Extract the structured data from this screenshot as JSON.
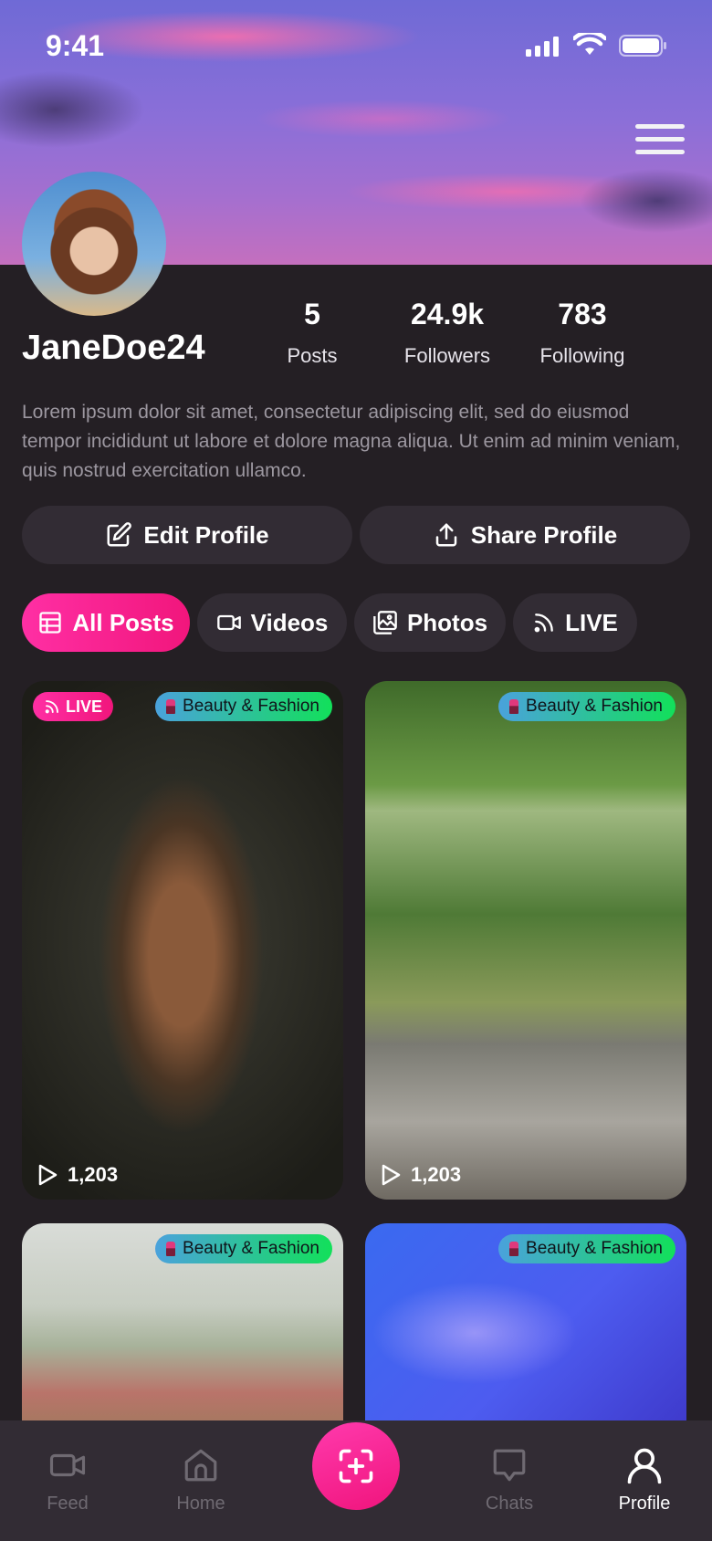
{
  "status_bar": {
    "time": "9:41"
  },
  "profile": {
    "username": "JaneDoe24",
    "stats": [
      {
        "value": "5",
        "label": "Posts"
      },
      {
        "value": "24.9k",
        "label": "Followers"
      },
      {
        "value": "783",
        "label": "Following"
      }
    ],
    "bio": "Lorem ipsum dolor sit amet, consectetur adipiscing elit, sed do eiusmod tempor incididunt ut labore et dolore magna aliqua. Ut enim ad minim veniam, quis nostrud exercitation ullamco."
  },
  "actions": {
    "edit": "Edit Profile",
    "share": "Share Profile"
  },
  "tabs": [
    {
      "label": "All Posts",
      "icon": "grid-icon",
      "active": true
    },
    {
      "label": "Videos",
      "icon": "video-camera-icon",
      "active": false
    },
    {
      "label": "Photos",
      "icon": "photos-icon",
      "active": false
    },
    {
      "label": "LIVE",
      "icon": "broadcast-icon",
      "active": false
    }
  ],
  "posts": [
    {
      "category": "Beauty & Fashion",
      "live_label": "LIVE",
      "views": "1,203"
    },
    {
      "category": "Beauty & Fashion",
      "views": "1,203"
    },
    {
      "category": "Beauty & Fashion"
    },
    {
      "category": "Beauty & Fashion"
    }
  ],
  "nav": [
    {
      "label": "Feed",
      "icon": "video-camera-icon"
    },
    {
      "label": "Home",
      "icon": "home-icon"
    },
    {
      "label": "",
      "icon": "add-post-icon"
    },
    {
      "label": "Chats",
      "icon": "chat-bubble-icon"
    },
    {
      "label": "Profile",
      "icon": "user-icon",
      "active": true
    }
  ],
  "colors": {
    "accent": "#f5178a",
    "background": "#241f24",
    "surface": "#322c34",
    "category_gradient_start": "#4aa2dc",
    "category_gradient_end": "#12e05a"
  }
}
